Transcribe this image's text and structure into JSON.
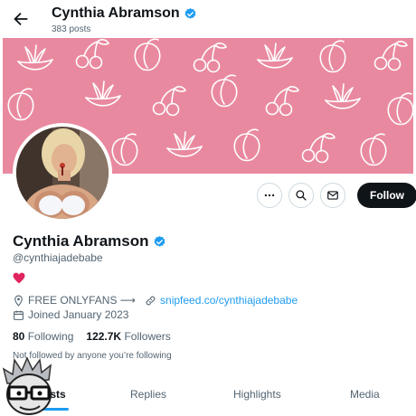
{
  "header": {
    "display_name": "Cynthia Abramson",
    "post_count": "383 posts"
  },
  "profile": {
    "display_name": "Cynthia Abramson",
    "handle": "@cynthiajadebabe",
    "bio_emoji": "heart",
    "location": "FREE ONLYFANS ⟶",
    "website": "snipfeed.co/cynthiajadebabe",
    "joined": "Joined January 2023",
    "following_count": "80",
    "following_label": "Following",
    "followers_count": "122.7K",
    "followers_label": "Followers",
    "not_followed_text": "Not followed by anyone you’re following"
  },
  "actions": {
    "follow_label": "Follow"
  },
  "tabs": [
    {
      "label": "Posts",
      "active": true
    },
    {
      "label": "Replies",
      "active": false
    },
    {
      "label": "Highlights",
      "active": false
    },
    {
      "label": "Media",
      "active": false
    }
  ],
  "colors": {
    "banner_pink": "#e9899f",
    "accent_blue": "#1d9bf0",
    "text_dark": "#0f1419",
    "text_gray": "#536471"
  },
  "icons": [
    "back-arrow-icon",
    "verified-badge-icon",
    "more-icon",
    "search-icon",
    "message-icon",
    "location-icon",
    "link-icon",
    "calendar-icon"
  ]
}
